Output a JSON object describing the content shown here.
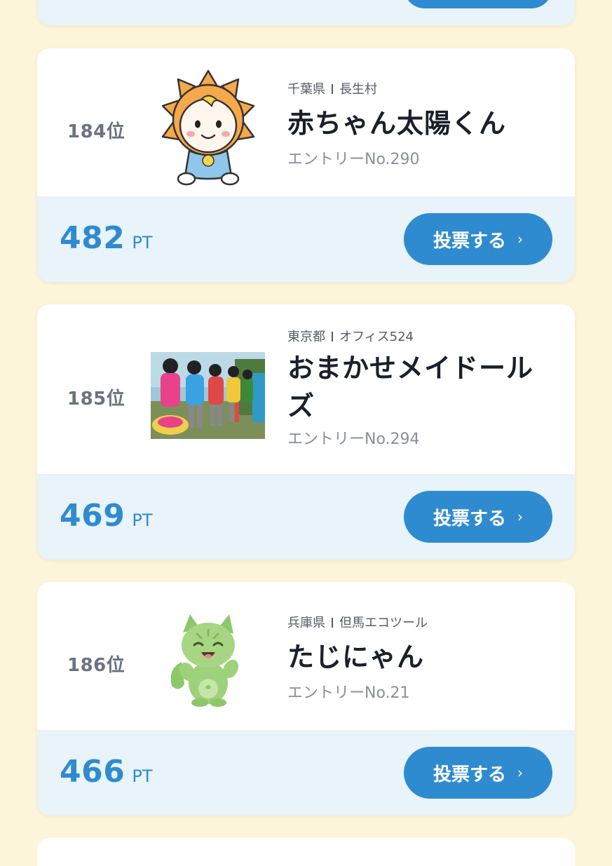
{
  "entries": [
    {
      "rank": "184位",
      "prefecture": "千葉県",
      "municipality": "長生村",
      "name": "赤ちゃん太陽くん",
      "entry": "エントリーNo.290",
      "points": "482",
      "points_unit": "PT",
      "vote_label": "投票する",
      "image_icon": "sun-baby-mascot-icon"
    },
    {
      "rank": "185位",
      "prefecture": "東京都",
      "municipality": "オフィス524",
      "name": "おまかせメイドールズ",
      "entry": "エントリーNo.294",
      "points": "469",
      "points_unit": "PT",
      "vote_label": "投票する",
      "image_icon": "maid-robot-group-photo"
    },
    {
      "rank": "186位",
      "prefecture": "兵庫県",
      "municipality": "但馬エコツール",
      "name": "たじにゃん",
      "entry": "エントリーNo.21",
      "points": "466",
      "points_unit": "PT",
      "vote_label": "投票する",
      "image_icon": "green-cat-mascot-icon"
    }
  ],
  "colors": {
    "page_background": "#fdf5da",
    "accent_blue": "#2f8bd0",
    "footer_background": "#e8f3fa"
  }
}
